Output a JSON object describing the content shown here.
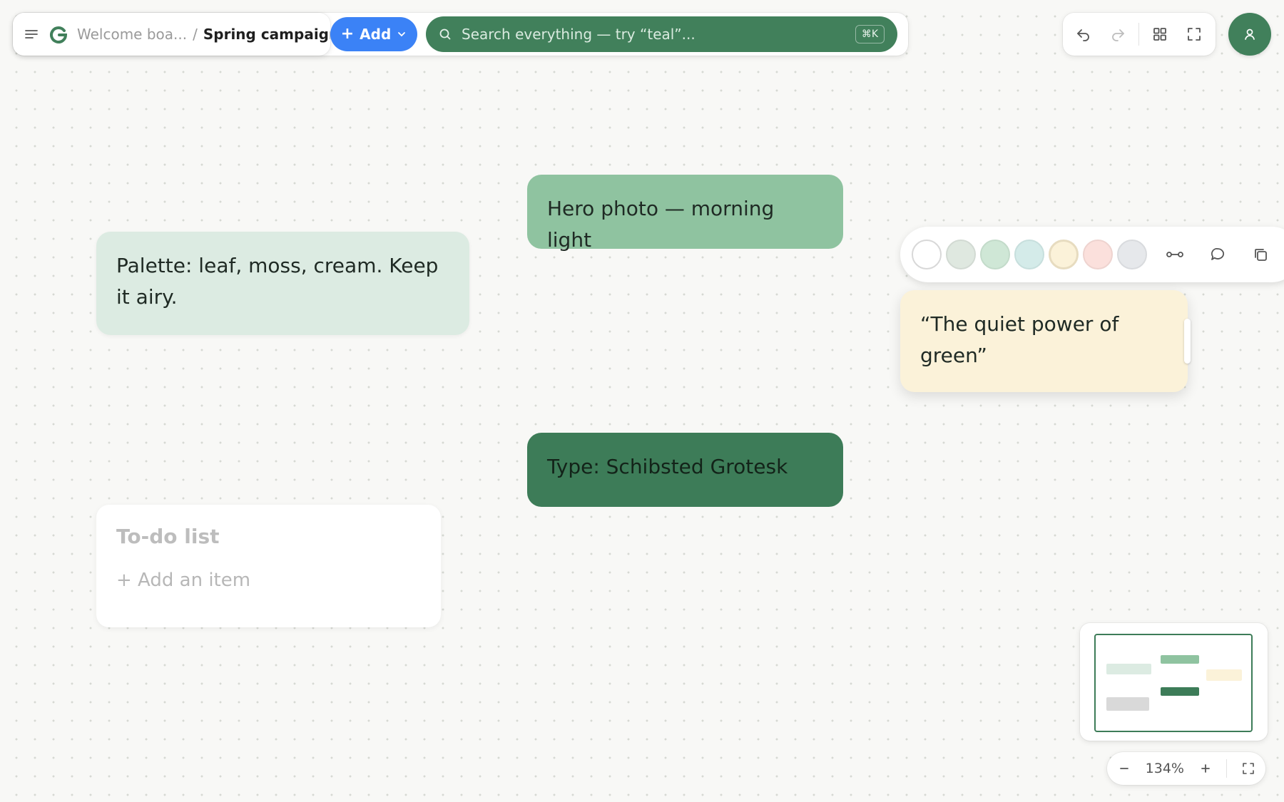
{
  "breadcrumb": {
    "parent": "Welcome boa...",
    "separator": "/",
    "current": "Spring campaign"
  },
  "toolbar": {
    "add_label": "Add",
    "search_placeholder": "Search everything — try “teal”...",
    "search_shortcut": "⌘K"
  },
  "notes": {
    "palette": "Palette: leaf, moss, cream. Keep it airy.",
    "hero": "Hero photo — morning light",
    "type": "Type: Schibsted Grotesk",
    "quote": "“The quiet power of green”"
  },
  "todo": {
    "title": "To-do list",
    "add_item": "+ Add an item"
  },
  "color_toolbar": {
    "swatches": [
      "#ffffff",
      "#dfe8e0",
      "#cfe7d6",
      "#d4ebe9",
      "#fbf2d9",
      "#fbe0dc",
      "#e6e8eb"
    ],
    "selected_swatch": "#fbf2d9"
  },
  "zoom": {
    "level": "134%"
  },
  "colors": {
    "accent_green": "#41805b",
    "add_blue": "#3b82f6",
    "note_mint": "#dcebe2",
    "note_sage": "#8fc3a0",
    "note_moss": "#3d7c58",
    "note_cream": "#fbf2d9"
  }
}
